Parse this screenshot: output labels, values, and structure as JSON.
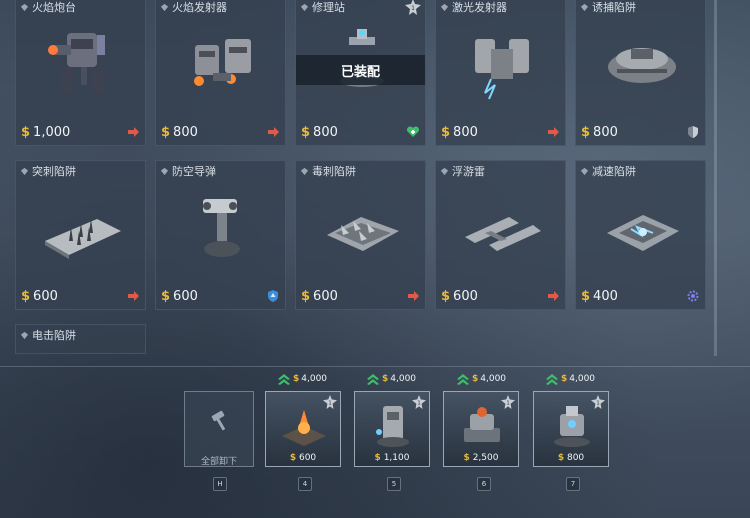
{
  "colors": {
    "accent_gold": "#e6b93b",
    "red_arrow": "#e05a4a",
    "green": "#3cbf6a",
    "panel": "#34404f"
  },
  "defenses": [
    {
      "name": "火焰炮台",
      "price": "1,000",
      "icon": "red-arrow-icon"
    },
    {
      "name": "火焰发射器",
      "price": "800",
      "icon": "red-arrow-icon"
    },
    {
      "name": "修理站",
      "price": "800",
      "icon": "green-heart-icon",
      "rank": "1",
      "status": "已装配"
    },
    {
      "name": "激光发射器",
      "price": "800",
      "icon": "red-arrow-icon"
    },
    {
      "name": "诱捕陷阱",
      "price": "800",
      "icon": "shield-icon"
    },
    {
      "name": "突刺陷阱",
      "price": "600",
      "icon": "red-arrow-icon"
    },
    {
      "name": "防空导弹",
      "price": "600",
      "icon": "blue-shield-icon"
    },
    {
      "name": "毒刺陷阱",
      "price": "600",
      "icon": "red-arrow-icon"
    },
    {
      "name": "浮游雷",
      "price": "600",
      "icon": "red-arrow-icon"
    },
    {
      "name": "减速陷阱",
      "price": "400",
      "icon": "gear-icon"
    },
    {
      "name": "电击陷阱"
    }
  ],
  "bottom": {
    "unequip_label": "全部卸下",
    "unequip_key": "H",
    "slots": [
      {
        "cost": "4,000",
        "price": "600",
        "key": "4",
        "rank": "1"
      },
      {
        "cost": "4,000",
        "price": "1,100",
        "key": "5",
        "rank": "1"
      },
      {
        "cost": "4,000",
        "price": "2,500",
        "key": "6",
        "rank": "1"
      },
      {
        "cost": "4,000",
        "price": "800",
        "key": "7",
        "rank": "1"
      }
    ]
  }
}
